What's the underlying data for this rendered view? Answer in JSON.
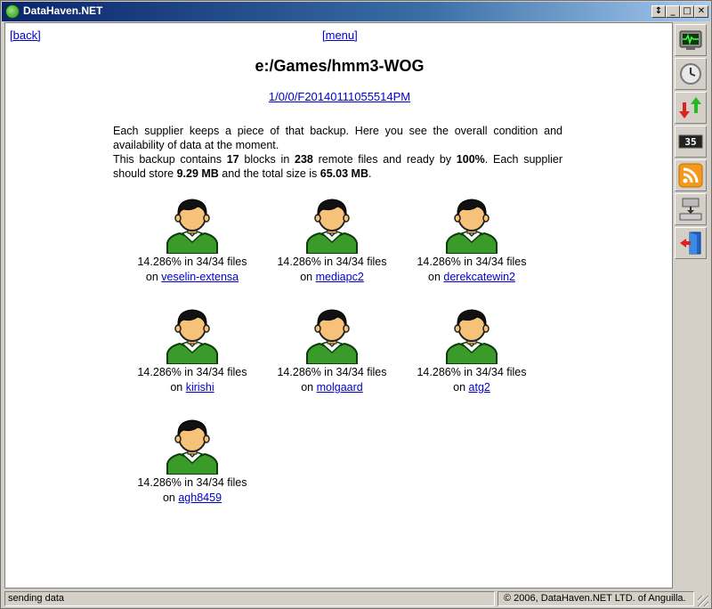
{
  "window": {
    "title": "DataHaven.NET",
    "buttons": {
      "restore_extra": "↕",
      "minimize": "_",
      "maximize": "□",
      "close": "✕"
    }
  },
  "nav": {
    "back": "[back]",
    "menu": "[menu]"
  },
  "page": {
    "title": "e:/Games/hmm3-WOG",
    "backup_id": "1/0/0/F20140111055514PM",
    "description": {
      "line1": "Each supplier keeps a piece of that backup. Here you see the overall condition and availability of data at the moment.",
      "p2_a": "This backup contains ",
      "blocks": "17",
      "p2_b": " blocks in ",
      "files": "238",
      "p2_c": " remote files and ready by ",
      "ready": "100%",
      "p2_d": ". Each supplier should store ",
      "per_supplier": "9.29 MB",
      "p2_e": " and the total size is ",
      "total": "65.03 MB",
      "p2_f": "."
    }
  },
  "suppliers": [
    {
      "stat": "14.286% in 34/34 files",
      "on": "on ",
      "name": "veselin-extensa"
    },
    {
      "stat": "14.286% in 34/34 files",
      "on": "on ",
      "name": "mediapc2"
    },
    {
      "stat": "14.286% in 34/34 files",
      "on": "on ",
      "name": "derekcatewin2"
    },
    {
      "stat": "14.286% in 34/34 files",
      "on": "on ",
      "name": "kirishi"
    },
    {
      "stat": "14.286% in 34/34 files",
      "on": "on ",
      "name": "molgaard"
    },
    {
      "stat": "14.286% in 34/34 files",
      "on": "on ",
      "name": "atg2"
    },
    {
      "stat": "14.286% in 34/34 files",
      "on": "on ",
      "name": "agh8459"
    }
  ],
  "toolbar": {
    "icons": [
      "monitor-icon",
      "clock-icon",
      "transfer-arrows-icon",
      "counter-icon",
      "rss-icon",
      "network-icon",
      "exit-door-icon"
    ],
    "counter_text": "35"
  },
  "status": {
    "left": "sending data",
    "right": "© 2006, DataHaven.NET LTD. of Anguilla."
  },
  "colors": {
    "title_start": "#0a246a",
    "link": "#0000cc",
    "avatar_shirt": "#3a9a2a",
    "avatar_hair": "#111111",
    "avatar_skin": "#f6c27a"
  }
}
